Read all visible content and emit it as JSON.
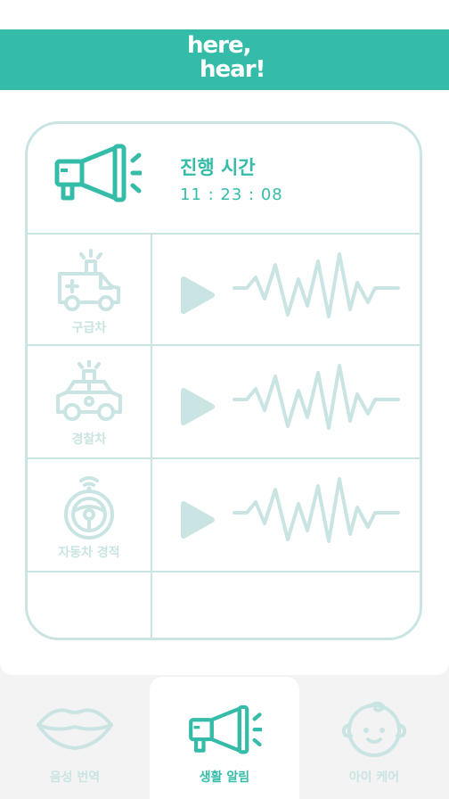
{
  "app": {
    "logo_line1": "here,",
    "logo_line2": "hear!"
  },
  "status": {
    "label": "진행 시간",
    "elapsed": "11 : 23 : 08"
  },
  "alerts": [
    {
      "label": "구급차",
      "icon": "ambulance-icon"
    },
    {
      "label": "경찰차",
      "icon": "police-car-icon"
    },
    {
      "label": "자동차 경적",
      "icon": "steering-wheel-icon"
    }
  ],
  "tabs": [
    {
      "label": "음성 번역",
      "icon": "lips-icon",
      "active": false
    },
    {
      "label": "생활 알림",
      "icon": "megaphone-icon",
      "active": true
    },
    {
      "label": "아이 케어",
      "icon": "baby-face-icon",
      "active": false
    }
  ],
  "colors": {
    "accent": "#35bca8",
    "muted": "#c9e4e3",
    "background": "#f3f3f3"
  }
}
